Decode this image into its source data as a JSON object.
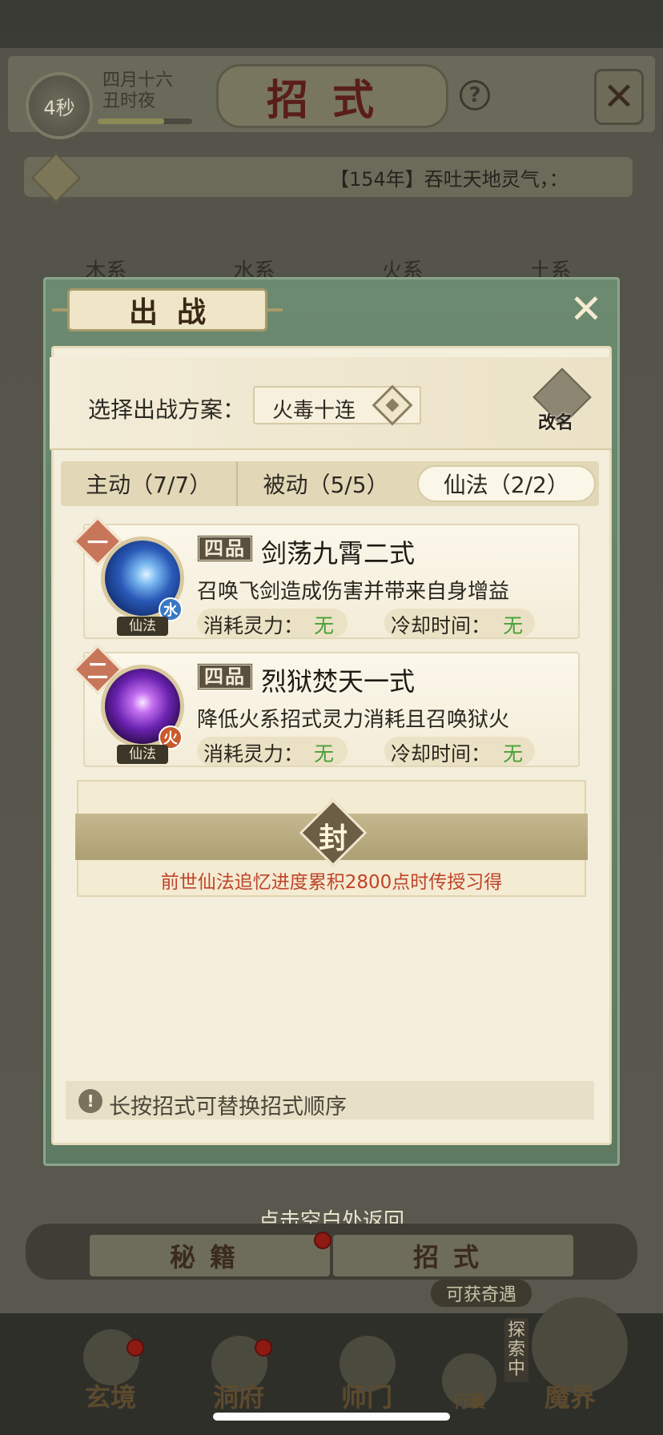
{
  "top": {
    "timer": "4秒",
    "date_line1": "四月十六",
    "date_line2": "丑时夜",
    "title": "招式",
    "help": "?",
    "ticker": "【154年】吞吐天地灵气，："
  },
  "background_tabs": [
    "木系",
    "水系",
    "火系",
    "土系"
  ],
  "modal": {
    "title": "出战",
    "plan_label": "选择出战方案：",
    "plan_value": "火毒十连",
    "rename": "改名",
    "tabs": [
      {
        "label": "主动（7/7）",
        "active": false
      },
      {
        "label": "被动（5/5）",
        "active": false
      },
      {
        "label": "仙法（2/2）",
        "active": true
      }
    ],
    "skills": [
      {
        "index": "一",
        "grade": "四品",
        "name": "剑荡九霄二式",
        "desc": "召唤飞剑造成伤害并带来自身增益",
        "element": "水",
        "type_tag": "仙法",
        "cost_label": "消耗灵力：",
        "cost_value": "无",
        "cooldown_label": "冷却时间：",
        "cooldown_value": "无",
        "icon": "sword-water-icon"
      },
      {
        "index": "二",
        "grade": "四品",
        "name": "烈狱焚天一式",
        "desc": "降低火系招式灵力消耗且召唤狱火",
        "element": "火",
        "type_tag": "仙法",
        "cost_label": "消耗灵力：",
        "cost_value": "无",
        "cooldown_label": "冷却时间：",
        "cooldown_value": "无",
        "icon": "hellfire-icon"
      }
    ],
    "sealed": {
      "badge": "封",
      "note": "前世仙法追忆进度累积2800点时传授习得"
    },
    "hint": "长按招式可替换招式顺序"
  },
  "return_hint": "点击空白处返回",
  "bottom_tabs": [
    "秘籍",
    "招式"
  ],
  "adventure": "可获奇遇",
  "explore": "探索中",
  "nav": [
    "玄境",
    "洞府",
    "师门",
    "行囊",
    "魔界"
  ],
  "colors": {
    "modal_green": "#6c8a70",
    "parchment": "#f4efdc",
    "value_green": "#4aa03a",
    "note_red": "#c0442a"
  }
}
